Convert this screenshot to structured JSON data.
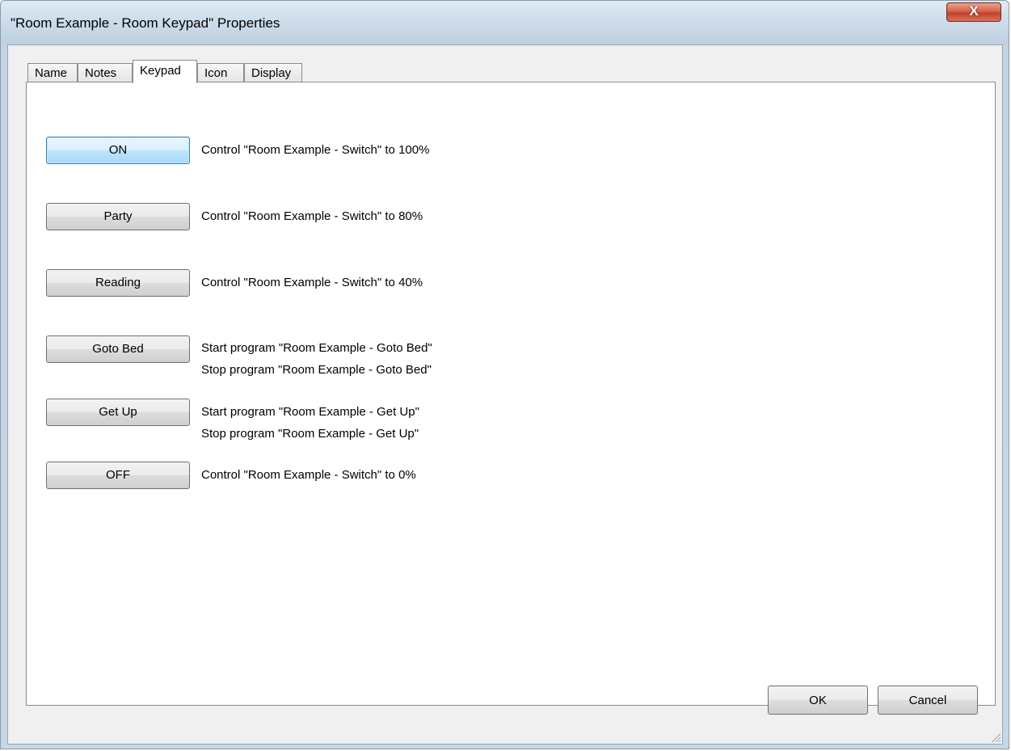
{
  "window": {
    "title": "\"Room Example - Room Keypad\" Properties",
    "close_glyph": "X"
  },
  "tabs": [
    {
      "label": "Name"
    },
    {
      "label": "Notes"
    },
    {
      "label": "Keypad",
      "active": true
    },
    {
      "label": "Icon"
    },
    {
      "label": "Display"
    }
  ],
  "keypad": {
    "on": {
      "label": "ON",
      "actions": [
        "Control \"Room Example - Switch\" to 100%"
      ]
    },
    "party": {
      "label": "Party",
      "actions": [
        "Control \"Room Example - Switch\" to 80%"
      ]
    },
    "reading": {
      "label": "Reading",
      "actions": [
        "Control \"Room Example - Switch\" to 40%"
      ]
    },
    "goto_bed": {
      "label": "Goto Bed",
      "actions": [
        "Start program \"Room Example - Goto Bed\"",
        "Stop program \"Room Example - Goto Bed\""
      ]
    },
    "get_up": {
      "label": "Get Up",
      "actions": [
        "Start program \"Room Example - Get Up\"",
        "Stop program \"Room Example - Get Up\""
      ]
    },
    "off": {
      "label": "OFF",
      "actions": [
        "Control \"Room Example - Switch\" to 0%"
      ]
    }
  },
  "footer": {
    "ok_label": "OK",
    "cancel_label": "Cancel"
  },
  "colors": {
    "focus_accent": "#3c7fb1",
    "close_button": "#c2412a"
  }
}
